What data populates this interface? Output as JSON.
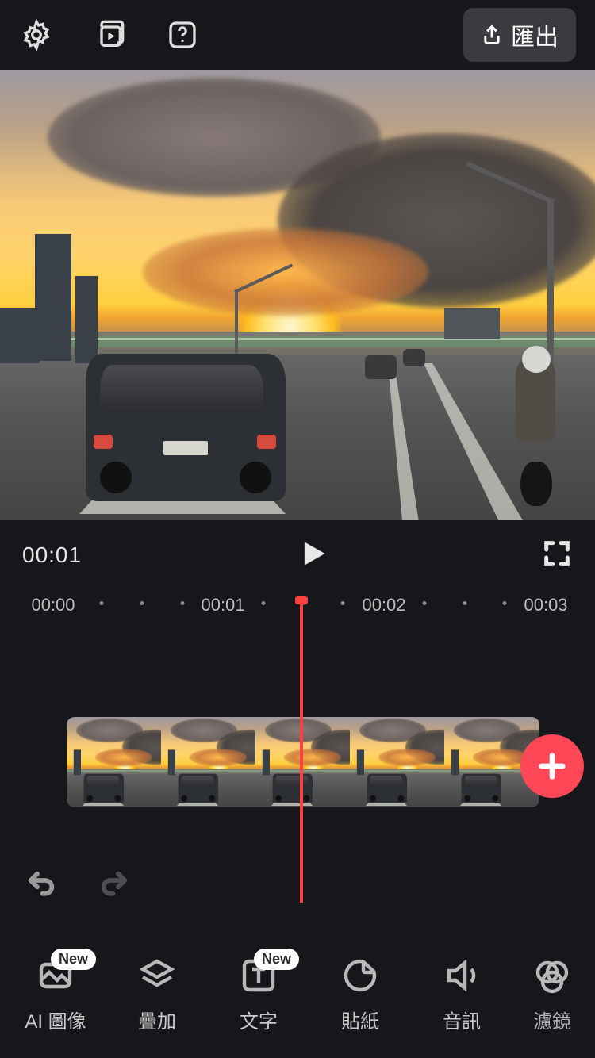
{
  "header": {
    "export_label": "匯出"
  },
  "playback": {
    "current_time": "00:01"
  },
  "ruler": {
    "ticks": [
      "00:00",
      "00:01",
      "00:02",
      "00:03"
    ]
  },
  "badges": {
    "new": "New"
  },
  "toolbar": {
    "items": [
      {
        "id": "ai-image",
        "label": "AI 圖像",
        "badge": "new"
      },
      {
        "id": "overlay",
        "label": "疊加"
      },
      {
        "id": "text",
        "label": "文字",
        "badge": "new"
      },
      {
        "id": "sticker",
        "label": "貼紙"
      },
      {
        "id": "audio",
        "label": "音訊"
      },
      {
        "id": "filter",
        "label": "濾鏡"
      }
    ]
  }
}
